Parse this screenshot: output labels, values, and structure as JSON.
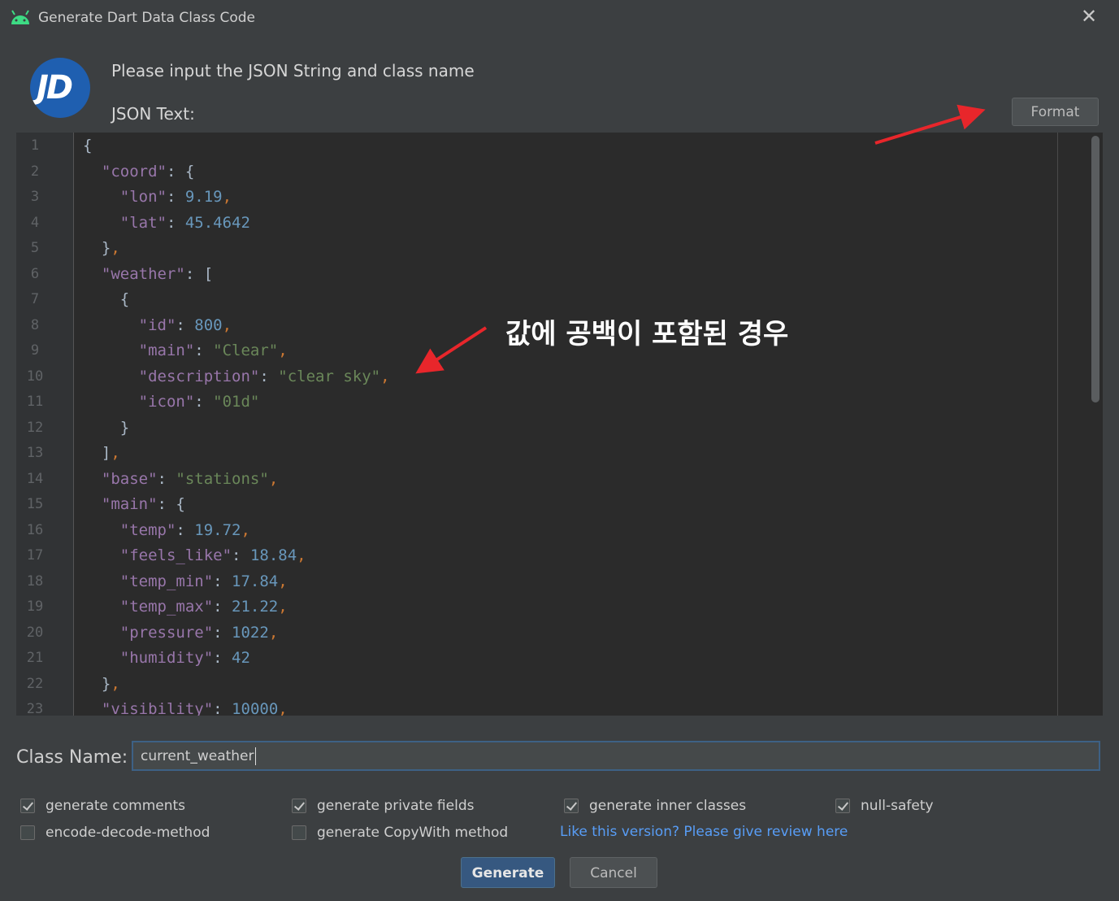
{
  "window": {
    "title": "Generate Dart Data Class Code",
    "close_icon": "close-icon",
    "app_icon": "android-icon"
  },
  "logo": {
    "text": "JD",
    "color": "#1f5fb0"
  },
  "header": {
    "prompt": "Please input the JSON String and class name",
    "json_label": "JSON Text:"
  },
  "format_button": {
    "label": "Format"
  },
  "editor": {
    "lines": [
      {
        "n": "1",
        "html": "{"
      },
      {
        "n": "2",
        "html": "  <span class=\"k\">\"coord\"</span>: {"
      },
      {
        "n": "3",
        "html": "    <span class=\"k\">\"lon\"</span>: <span class=\"n\">9.19</span><span class=\"p\">,</span>"
      },
      {
        "n": "4",
        "html": "    <span class=\"k\">\"lat\"</span>: <span class=\"n\">45.4642</span>"
      },
      {
        "n": "5",
        "html": "  }<span class=\"p\">,</span>"
      },
      {
        "n": "6",
        "html": "  <span class=\"k\">\"weather\"</span>: ["
      },
      {
        "n": "7",
        "html": "    {"
      },
      {
        "n": "8",
        "html": "      <span class=\"k\">\"id\"</span>: <span class=\"n\">800</span><span class=\"p\">,</span>"
      },
      {
        "n": "9",
        "html": "      <span class=\"k\">\"main\"</span>: <span class=\"s\">\"Clear\"</span><span class=\"p\">,</span>"
      },
      {
        "n": "10",
        "html": "      <span class=\"k\">\"description\"</span>: <span class=\"s\">\"clear sky\"</span><span class=\"p\">,</span>"
      },
      {
        "n": "11",
        "html": "      <span class=\"k\">\"icon\"</span>: <span class=\"s\">\"01d\"</span>"
      },
      {
        "n": "12",
        "html": "    }"
      },
      {
        "n": "13",
        "html": "  ]<span class=\"p\">,</span>"
      },
      {
        "n": "14",
        "html": "  <span class=\"k\">\"base\"</span>: <span class=\"s\">\"stations\"</span><span class=\"p\">,</span>"
      },
      {
        "n": "15",
        "html": "  <span class=\"k\">\"main\"</span>: {"
      },
      {
        "n": "16",
        "html": "    <span class=\"k\">\"temp\"</span>: <span class=\"n\">19.72</span><span class=\"p\">,</span>"
      },
      {
        "n": "17",
        "html": "    <span class=\"k\">\"feels_like\"</span>: <span class=\"n\">18.84</span><span class=\"p\">,</span>"
      },
      {
        "n": "18",
        "html": "    <span class=\"k\">\"temp_min\"</span>: <span class=\"n\">17.84</span><span class=\"p\">,</span>"
      },
      {
        "n": "19",
        "html": "    <span class=\"k\">\"temp_max\"</span>: <span class=\"n\">21.22</span><span class=\"p\">,</span>"
      },
      {
        "n": "20",
        "html": "    <span class=\"k\">\"pressure\"</span>: <span class=\"n\">1022</span><span class=\"p\">,</span>"
      },
      {
        "n": "21",
        "html": "    <span class=\"k\">\"humidity\"</span>: <span class=\"n\">42</span>"
      },
      {
        "n": "22",
        "html": "  }<span class=\"p\">,</span>"
      },
      {
        "n": "23",
        "html": "  <span class=\"k\">\"visibility\"</span>: <span class=\"n\">10000</span><span class=\"p\">,</span>"
      }
    ]
  },
  "class_name": {
    "label": "Class Name:",
    "value": "current_weather"
  },
  "options": [
    {
      "label": "generate comments",
      "checked": true
    },
    {
      "label": "generate private fields",
      "checked": true
    },
    {
      "label": "generate inner classes",
      "checked": true
    },
    {
      "label": "null-safety",
      "checked": true
    },
    {
      "label": "encode-decode-method",
      "checked": false
    },
    {
      "label": "generate CopyWith method",
      "checked": false
    }
  ],
  "review_link": "Like this version? Please give review here",
  "buttons": {
    "generate": "Generate",
    "cancel": "Cancel"
  },
  "annotation": {
    "text": "값에 공백이 포함된 경우",
    "arrow_color": "#e8262b"
  }
}
